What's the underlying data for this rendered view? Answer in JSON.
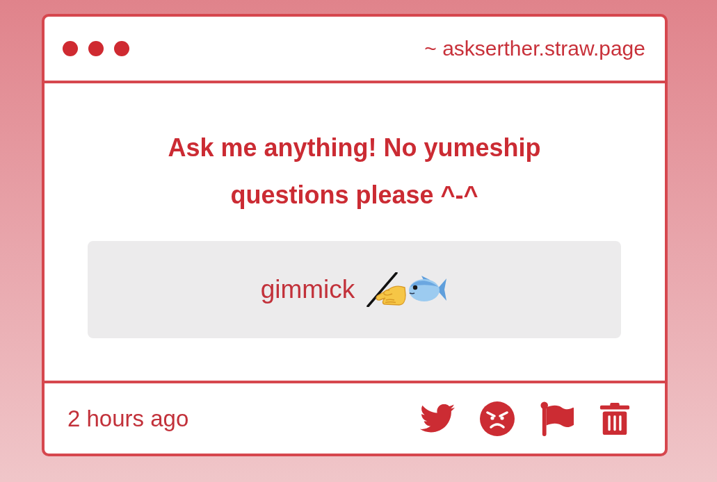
{
  "window": {
    "address": "~ askserther.straw.page"
  },
  "prompt": "Ask me anything! No yumeship questions please ^-^",
  "question": {
    "text": "gimmick"
  },
  "footer": {
    "time": "2 hours ago"
  }
}
